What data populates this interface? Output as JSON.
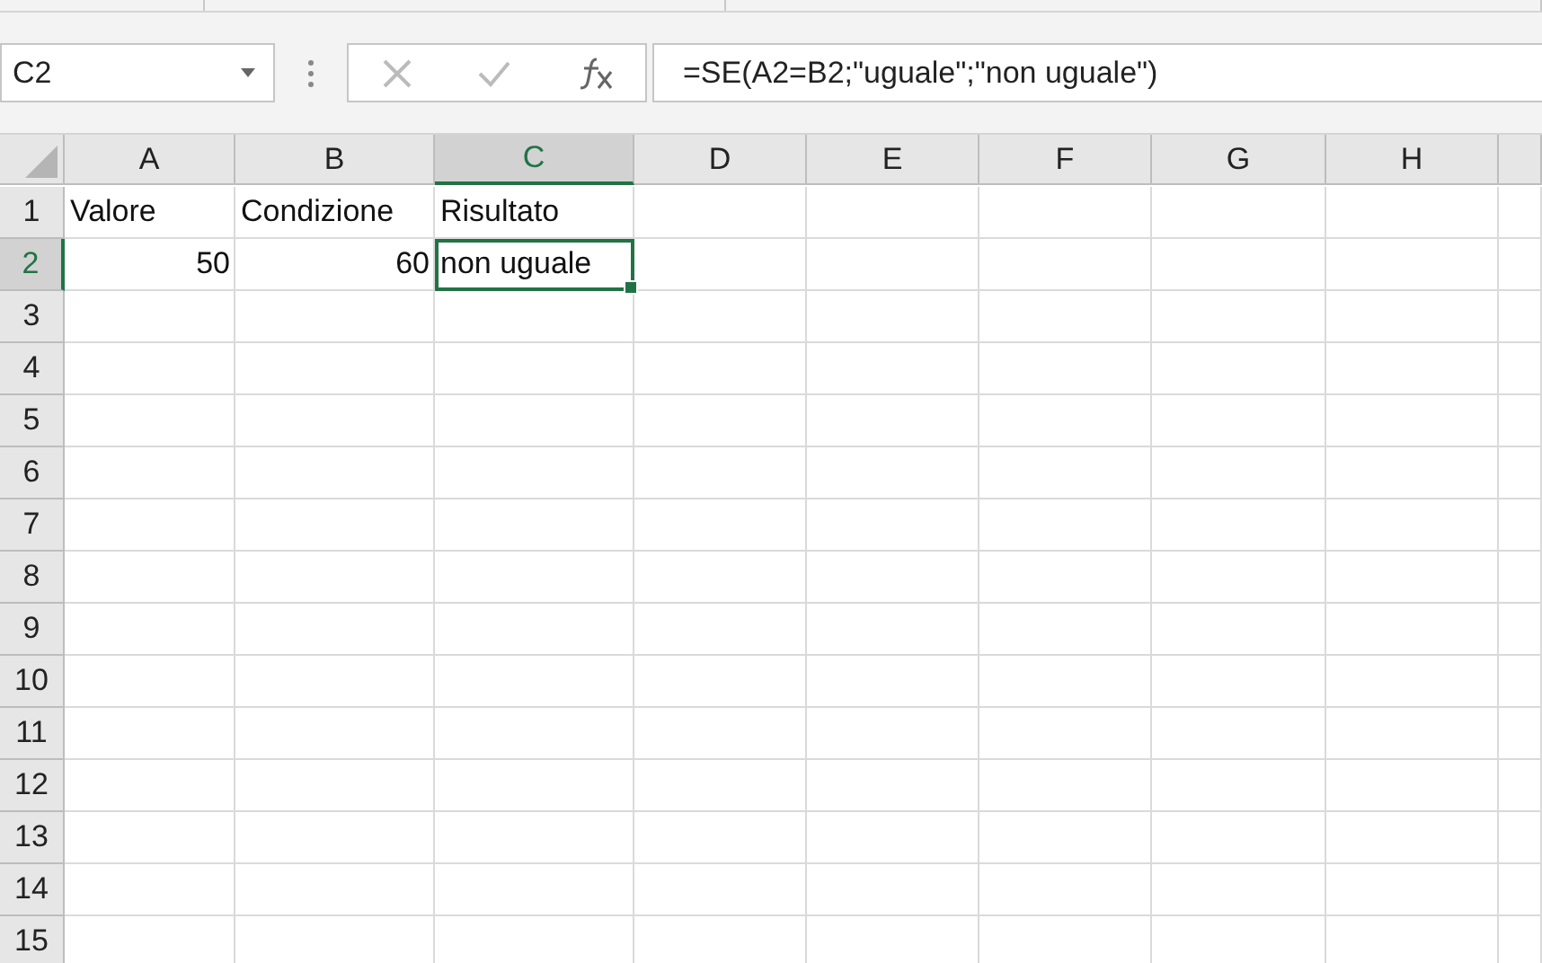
{
  "formula_bar": {
    "name_box": "C2",
    "formula": "=SE(A2=B2;\"uguale\";\"non uguale\")"
  },
  "sheet": {
    "columns": [
      {
        "label": "A",
        "selected": false
      },
      {
        "label": "B",
        "selected": false
      },
      {
        "label": "C",
        "selected": true
      },
      {
        "label": "D",
        "selected": false
      },
      {
        "label": "E",
        "selected": false
      },
      {
        "label": "F",
        "selected": false
      },
      {
        "label": "G",
        "selected": false
      },
      {
        "label": "H",
        "selected": false
      }
    ],
    "rows": [
      {
        "label": "1",
        "selected": false,
        "cells": [
          {
            "text": "Valore",
            "kind": "text",
            "selected": false
          },
          {
            "text": "Condizione",
            "kind": "text",
            "selected": false
          },
          {
            "text": "Risultato",
            "kind": "text",
            "selected": false
          }
        ]
      },
      {
        "label": "2",
        "selected": true,
        "cells": [
          {
            "text": "50",
            "kind": "number",
            "selected": false
          },
          {
            "text": "60",
            "kind": "number",
            "selected": false
          },
          {
            "text": "non uguale",
            "kind": "text",
            "selected": true
          }
        ]
      },
      {
        "label": "3",
        "selected": false
      },
      {
        "label": "4",
        "selected": false
      },
      {
        "label": "5",
        "selected": false
      },
      {
        "label": "6",
        "selected": false
      },
      {
        "label": "7",
        "selected": false
      },
      {
        "label": "8",
        "selected": false
      },
      {
        "label": "9",
        "selected": false
      },
      {
        "label": "10",
        "selected": false
      },
      {
        "label": "11",
        "selected": false
      },
      {
        "label": "12",
        "selected": false
      },
      {
        "label": "13",
        "selected": false
      },
      {
        "label": "14",
        "selected": false
      },
      {
        "label": "15",
        "selected": false
      }
    ]
  }
}
